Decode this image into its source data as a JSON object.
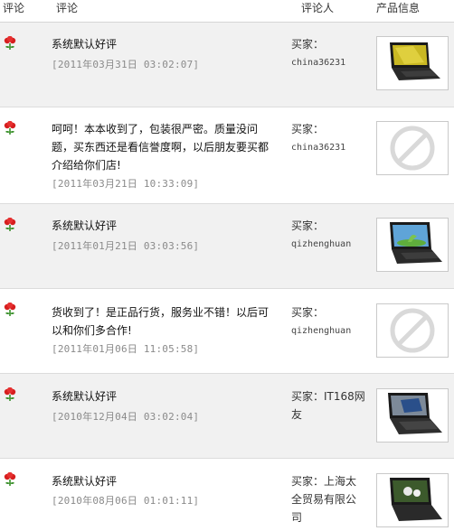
{
  "header": {
    "col_rating": "评论",
    "col_comment": "评论",
    "col_reviewer": "评论人",
    "col_product": "产品信息"
  },
  "reviews": [
    {
      "text": "系统默认好评",
      "date": "[2011年03月31日 03:02:07]",
      "role": "买家：",
      "reviewer": "china36231",
      "thumb_icon": "laptop-thumbnail"
    },
    {
      "text": "呵呵！本本收到了，包装很严密。质量没问题，买东西还是看信誉度啊，以后朋友要买都介绍给你们店!",
      "date": "[2011年03月21日 10:33:09]",
      "role": "买家：",
      "reviewer": "china36231",
      "thumb_icon": "no-image-icon"
    },
    {
      "text": "系统默认好评",
      "date": "[2011年01月21日 03:03:56]",
      "role": "买家：",
      "reviewer": "qizhenghuan",
      "thumb_icon": "laptop-thumbnail"
    },
    {
      "text": "货收到了！是正品行货，服务业不错！以后可以和你们多合作!",
      "date": "[2011年01月06日 11:05:58]",
      "role": "买家：",
      "reviewer": "qizhenghuan",
      "thumb_icon": "no-image-icon"
    },
    {
      "text": "系统默认好评",
      "date": "[2010年12月04日 03:02:04]",
      "role": "买家：IT168网友",
      "reviewer": "",
      "thumb_icon": "laptop-thumbnail"
    },
    {
      "text": "系统默认好评",
      "date": "[2010年08月06日 01:01:11]",
      "role": "买家：上海太全贸易有限公司",
      "reviewer": "",
      "thumb_icon": "laptop-thumbnail"
    }
  ],
  "colors": {
    "alt_row": "#f1f1f1",
    "date_text": "#8a8a8a",
    "flower_red": "#d61e1e",
    "flower_green": "#2f8a1f"
  }
}
